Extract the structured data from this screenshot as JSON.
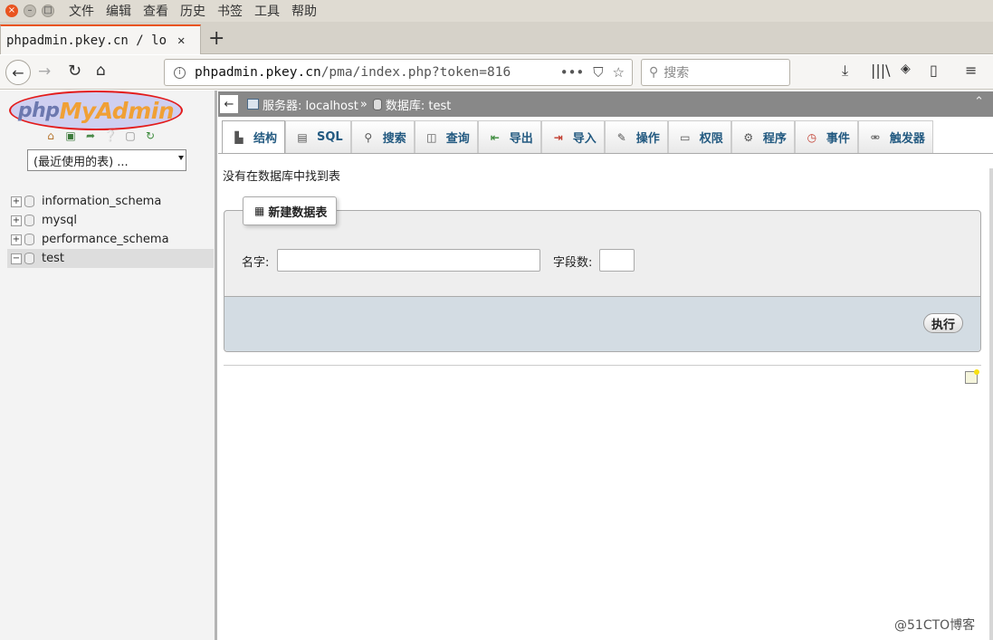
{
  "browser": {
    "menu": [
      "文件",
      "编辑",
      "查看",
      "历史",
      "书签",
      "工具",
      "帮助"
    ],
    "tab_title": "phpadmin.pkey.cn / lo",
    "url_host": "phpadmin.pkey.cn",
    "url_path": "/pma/index.php?token=816",
    "search_placeholder": "搜索",
    "accent": "#e95420"
  },
  "sidebar": {
    "logo_php": "php",
    "logo_myadmin": "MyAdmin",
    "recent_select": "(最近使用的表) ...",
    "databases": [
      {
        "name": "information_schema",
        "expander": "+"
      },
      {
        "name": "mysql",
        "expander": "+"
      },
      {
        "name": "performance_schema",
        "expander": "+"
      },
      {
        "name": "test",
        "expander": "−"
      }
    ]
  },
  "breadcrumb": {
    "server": "服务器: localhost",
    "separator": "»",
    "database": "数据库: test"
  },
  "tabs": [
    {
      "label": "结构",
      "icon": "structure-icon"
    },
    {
      "label": "SQL",
      "icon": "sql-icon"
    },
    {
      "label": "搜索",
      "icon": "search-icon"
    },
    {
      "label": "查询",
      "icon": "query-icon"
    },
    {
      "label": "导出",
      "icon": "export-icon"
    },
    {
      "label": "导入",
      "icon": "import-icon"
    },
    {
      "label": "操作",
      "icon": "operations-icon"
    },
    {
      "label": "权限",
      "icon": "privileges-icon"
    },
    {
      "label": "程序",
      "icon": "routines-icon"
    },
    {
      "label": "事件",
      "icon": "events-icon"
    },
    {
      "label": "触发器",
      "icon": "triggers-icon"
    }
  ],
  "main": {
    "no_tables": "没有在数据库中找到表",
    "create_legend": "新建数据表",
    "name_label": "名字:",
    "columns_label": "字段数:",
    "go_button": "执行"
  },
  "watermark": "@51CTO博客"
}
